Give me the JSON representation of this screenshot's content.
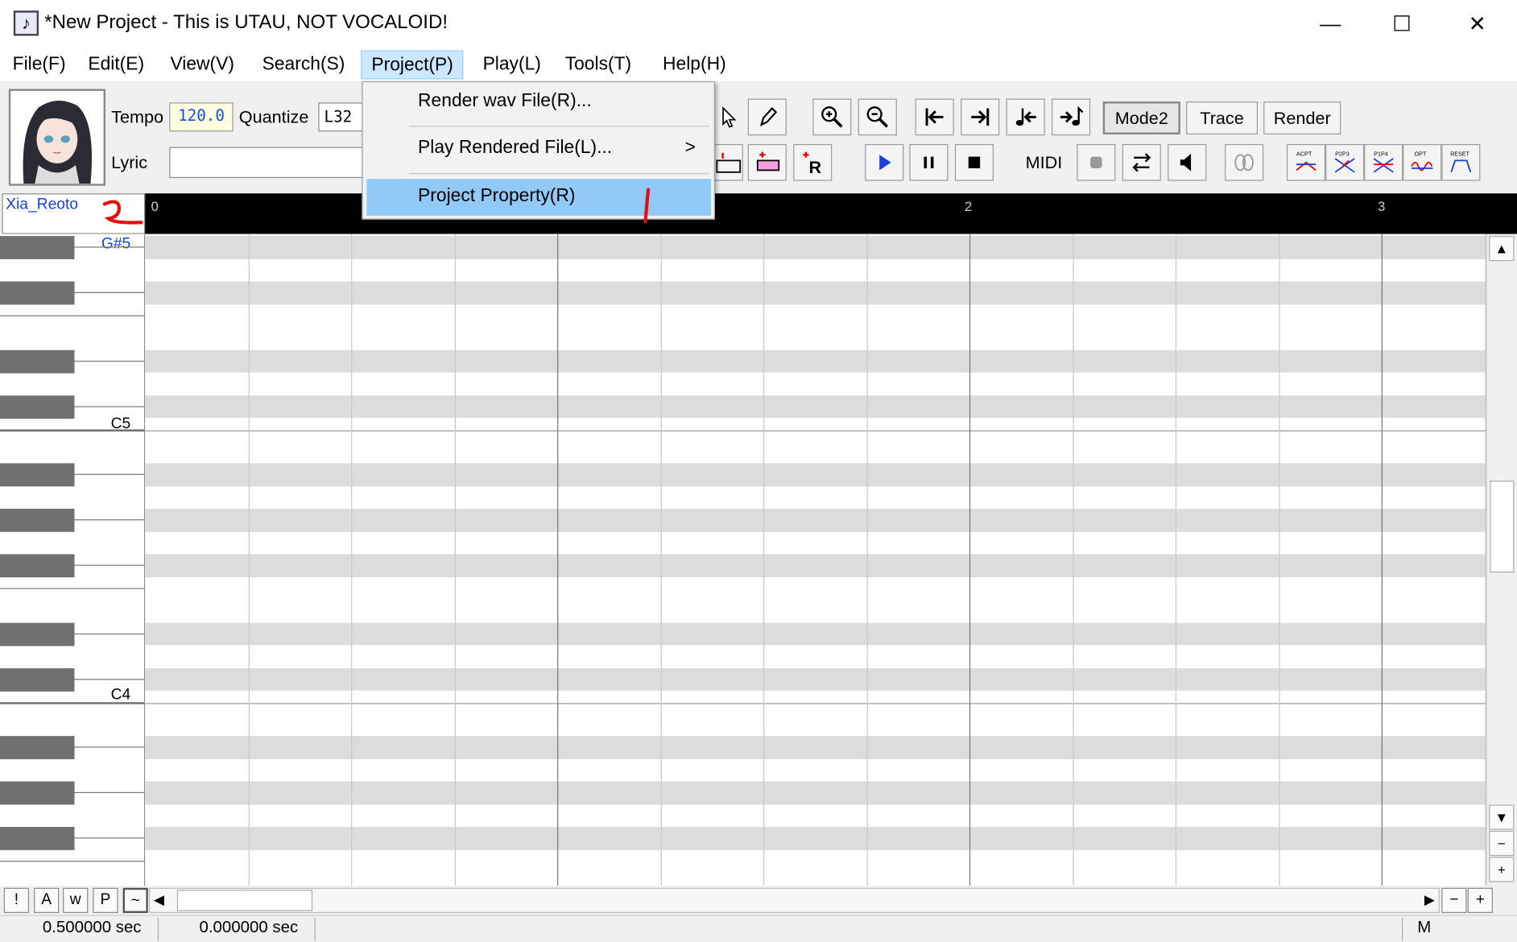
{
  "window": {
    "title": "*New Project - This is UTAU, NOT VOCALOID!",
    "app_icon": "♪",
    "minimize": "—",
    "maximize": "☐",
    "close": "✕"
  },
  "menubar": [
    "File(F)",
    "Edit(E)",
    "View(V)",
    "Search(S)",
    "Project(P)",
    "Play(L)",
    "Tools(T)",
    "Help(H)"
  ],
  "toolbar": {
    "tempo_label": "Tempo",
    "tempo_value": "120.0",
    "quantize_label": "Quantize",
    "quantize_value": "L32",
    "lyric_label": "Lyric",
    "lyric_value": "",
    "mode_button": "Mode2",
    "trace_button": "Trace",
    "render_button": "Render",
    "midi_label": "MIDI",
    "preset_labels": [
      "ACPT",
      "P2P3",
      "P1P4",
      "OPT",
      "RESET"
    ]
  },
  "project_menu": {
    "items": [
      "Render wav File(R)...",
      "Play Rendered File(L)...",
      "Project Property(R)"
    ],
    "submenu_arrow": ">",
    "highlighted": "Project Property(R)"
  },
  "track": {
    "singer_name": "Xia_Reoto"
  },
  "ruler": {
    "marks": [
      "0",
      "2",
      "3"
    ]
  },
  "piano_roll": {
    "key_labels": [
      "G#5",
      "C5",
      "C4"
    ]
  },
  "bottom_buttons": [
    "!",
    "A",
    "w",
    "P",
    "~"
  ],
  "scroll": {
    "up": "▲",
    "down": "▼",
    "left": "◀",
    "right": "▶",
    "minus": "−",
    "plus": "+"
  },
  "status": {
    "length": "0.500000 sec",
    "position": "0.000000 sec",
    "mode": "M"
  },
  "colors": {
    "menu_highlight": "#91c9f7",
    "tempo_text": "#1a4fd1",
    "singer_text": "#1a3fe0",
    "annotation": "#e01010"
  }
}
